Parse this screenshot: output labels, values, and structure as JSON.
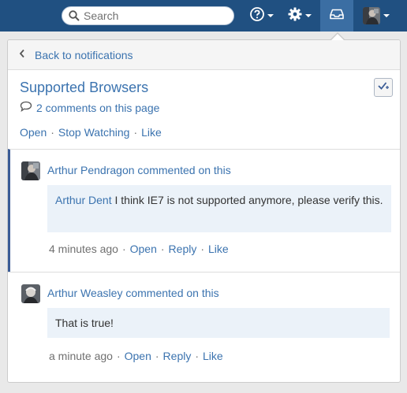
{
  "header": {
    "search": {
      "placeholder": "Search",
      "icon": "search-icon"
    },
    "help": {
      "icon": "help-icon"
    },
    "settings": {
      "icon": "gear-icon"
    },
    "inbox": {
      "icon": "inbox-icon",
      "active_color": "#3b6ea3"
    },
    "user": {
      "icon": "avatar"
    },
    "bar_color": "#205081"
  },
  "panel": {
    "back_label": "Back to notifications",
    "page_title": "Supported Browsers",
    "comment_count_label": "2 comments on this page",
    "actions": {
      "open": "Open",
      "stop_watching": "Stop Watching",
      "like": "Like"
    },
    "separator": "·",
    "comments": [
      {
        "author": "Arthur Pendragon",
        "verb": "commented on this",
        "mention": "Arthur Dent",
        "body": " I think IE7 is not supported anymore, please verify this.",
        "time": "4 minutes ago",
        "open": "Open",
        "reply": "Reply",
        "like": "Like"
      },
      {
        "author": "Arthur Weasley",
        "verb": "commented on this",
        "body": "That is true!",
        "time": "a minute ago",
        "open": "Open",
        "reply": "Reply",
        "like": "Like"
      }
    ]
  },
  "colors": {
    "link": "#3b73af",
    "highlight": "#ebf2f9",
    "accent_border": "#3b5c96"
  }
}
